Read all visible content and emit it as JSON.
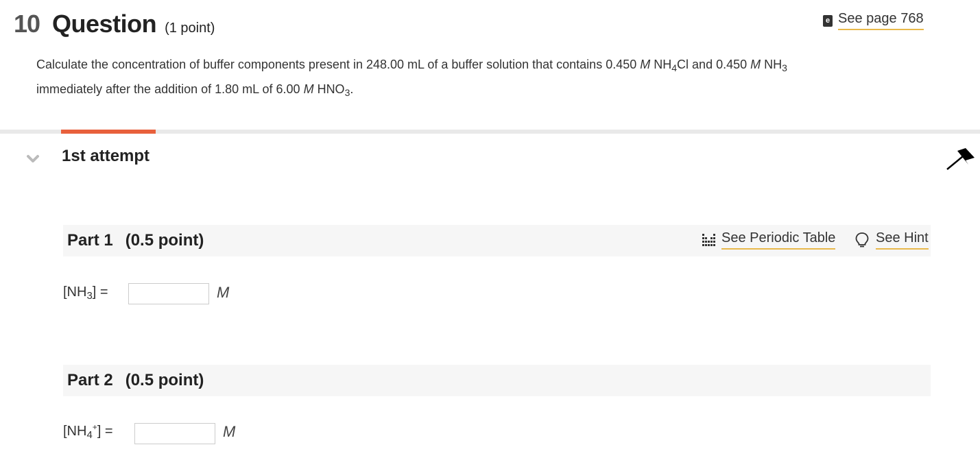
{
  "question": {
    "number": "10",
    "title": "Question",
    "points": "(1 point)",
    "see_page": "See page 768",
    "text_line1": {
      "a": "Calculate the concentration of buffer components present in 248.00 mL of a buffer solution that contains  0.450 ",
      "m1": "M",
      "b": " NH",
      "sub1": "4",
      "c": "Cl and 0.450 ",
      "m2": "M",
      "d": " NH",
      "sub2": "3"
    },
    "text_line2": {
      "a": "immediately after the addition of 1.80 mL of 6.00 ",
      "m": "M",
      "b": " HNO",
      "sub": "3",
      "c": "."
    }
  },
  "attempt": {
    "label": "1st attempt"
  },
  "tools": {
    "periodic_table": "See Periodic Table",
    "hint": "See Hint"
  },
  "parts": [
    {
      "title": "Part 1",
      "points": "(0.5 point)",
      "label_a": "[NH",
      "label_sub": "3",
      "label_b": "] =",
      "value": "",
      "unit": "M"
    },
    {
      "title": "Part 2",
      "points": "(0.5 point)",
      "label_a": "[NH",
      "label_sub": "4",
      "label_sup": "+",
      "label_b": "] =",
      "value": "",
      "unit": "M"
    }
  ],
  "colors": {
    "accent": "#e8603c",
    "link_underline": "#e8b84a",
    "part_bg": "#f6f6f6"
  }
}
